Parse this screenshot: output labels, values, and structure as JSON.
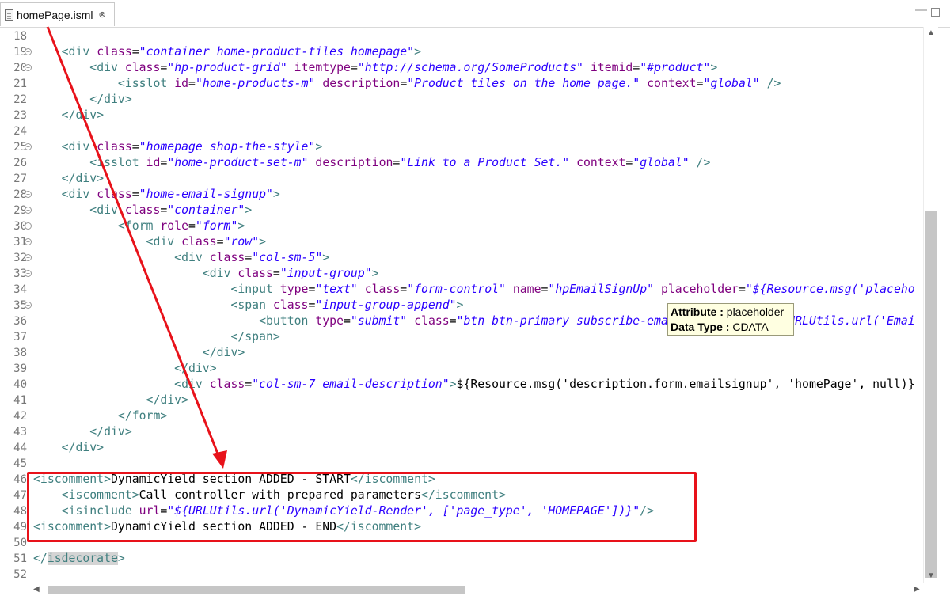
{
  "tab": {
    "filename": "homePage.isml",
    "close_glyph": "⊗"
  },
  "window": {
    "minimize_glyph": "—"
  },
  "lines": [
    {
      "n": "18",
      "fold": false,
      "parts": []
    },
    {
      "n": "19",
      "fold": true,
      "parts": [
        {
          "c": "",
          "x": "    "
        },
        {
          "c": "t",
          "x": "<div "
        },
        {
          "c": "a",
          "x": "class"
        },
        {
          "c": "",
          "x": "="
        },
        {
          "c": "v",
          "x": "\"container home-product-tiles homepage\""
        },
        {
          "c": "t",
          "x": ">"
        }
      ]
    },
    {
      "n": "20",
      "fold": true,
      "parts": [
        {
          "c": "",
          "x": "        "
        },
        {
          "c": "t",
          "x": "<div "
        },
        {
          "c": "a",
          "x": "class"
        },
        {
          "c": "",
          "x": "="
        },
        {
          "c": "v",
          "x": "\"hp-product-grid\""
        },
        {
          "c": "",
          "x": " "
        },
        {
          "c": "a",
          "x": "itemtype"
        },
        {
          "c": "",
          "x": "="
        },
        {
          "c": "v",
          "x": "\"http://schema.org/SomeProducts\""
        },
        {
          "c": "",
          "x": " "
        },
        {
          "c": "a",
          "x": "itemid"
        },
        {
          "c": "",
          "x": "="
        },
        {
          "c": "v",
          "x": "\"#product\""
        },
        {
          "c": "t",
          "x": ">"
        }
      ]
    },
    {
      "n": "21",
      "fold": false,
      "parts": [
        {
          "c": "",
          "x": "            "
        },
        {
          "c": "t",
          "x": "<isslot "
        },
        {
          "c": "a",
          "x": "id"
        },
        {
          "c": "",
          "x": "="
        },
        {
          "c": "v",
          "x": "\"home-products-m\""
        },
        {
          "c": "",
          "x": " "
        },
        {
          "c": "a",
          "x": "description"
        },
        {
          "c": "",
          "x": "="
        },
        {
          "c": "v",
          "x": "\"Product tiles on the home page.\""
        },
        {
          "c": "",
          "x": " "
        },
        {
          "c": "a",
          "x": "context"
        },
        {
          "c": "",
          "x": "="
        },
        {
          "c": "v",
          "x": "\"global\""
        },
        {
          "c": "",
          "x": " "
        },
        {
          "c": "t",
          "x": "/>"
        }
      ]
    },
    {
      "n": "22",
      "fold": false,
      "parts": [
        {
          "c": "",
          "x": "        "
        },
        {
          "c": "t",
          "x": "</div>"
        }
      ]
    },
    {
      "n": "23",
      "fold": false,
      "parts": [
        {
          "c": "",
          "x": "    "
        },
        {
          "c": "t",
          "x": "</div>"
        }
      ]
    },
    {
      "n": "24",
      "fold": false,
      "parts": []
    },
    {
      "n": "25",
      "fold": true,
      "parts": [
        {
          "c": "",
          "x": "    "
        },
        {
          "c": "t",
          "x": "<div "
        },
        {
          "c": "a",
          "x": "class"
        },
        {
          "c": "",
          "x": "="
        },
        {
          "c": "v",
          "x": "\"homepage shop-the-style\""
        },
        {
          "c": "t",
          "x": ">"
        }
      ]
    },
    {
      "n": "26",
      "fold": false,
      "parts": [
        {
          "c": "",
          "x": "        "
        },
        {
          "c": "t",
          "x": "<isslot "
        },
        {
          "c": "a",
          "x": "id"
        },
        {
          "c": "",
          "x": "="
        },
        {
          "c": "v",
          "x": "\"home-product-set-m\""
        },
        {
          "c": "",
          "x": " "
        },
        {
          "c": "a",
          "x": "description"
        },
        {
          "c": "",
          "x": "="
        },
        {
          "c": "v",
          "x": "\"Link to a Product Set.\""
        },
        {
          "c": "",
          "x": " "
        },
        {
          "c": "a",
          "x": "context"
        },
        {
          "c": "",
          "x": "="
        },
        {
          "c": "v",
          "x": "\"global\""
        },
        {
          "c": "",
          "x": " "
        },
        {
          "c": "t",
          "x": "/>"
        }
      ]
    },
    {
      "n": "27",
      "fold": false,
      "parts": [
        {
          "c": "",
          "x": "    "
        },
        {
          "c": "t",
          "x": "</div>"
        }
      ]
    },
    {
      "n": "28",
      "fold": true,
      "parts": [
        {
          "c": "",
          "x": "    "
        },
        {
          "c": "t",
          "x": "<div "
        },
        {
          "c": "a",
          "x": "class"
        },
        {
          "c": "",
          "x": "="
        },
        {
          "c": "v",
          "x": "\"home-email-signup\""
        },
        {
          "c": "t",
          "x": ">"
        }
      ]
    },
    {
      "n": "29",
      "fold": true,
      "parts": [
        {
          "c": "",
          "x": "        "
        },
        {
          "c": "t",
          "x": "<div "
        },
        {
          "c": "a",
          "x": "class"
        },
        {
          "c": "",
          "x": "="
        },
        {
          "c": "v",
          "x": "\"container\""
        },
        {
          "c": "t",
          "x": ">"
        }
      ]
    },
    {
      "n": "30",
      "fold": true,
      "parts": [
        {
          "c": "",
          "x": "            "
        },
        {
          "c": "t",
          "x": "<form "
        },
        {
          "c": "a",
          "x": "role"
        },
        {
          "c": "",
          "x": "="
        },
        {
          "c": "v",
          "x": "\"form\""
        },
        {
          "c": "t",
          "x": ">"
        }
      ]
    },
    {
      "n": "31",
      "fold": true,
      "parts": [
        {
          "c": "",
          "x": "                "
        },
        {
          "c": "t",
          "x": "<div "
        },
        {
          "c": "a",
          "x": "class"
        },
        {
          "c": "",
          "x": "="
        },
        {
          "c": "v",
          "x": "\"row\""
        },
        {
          "c": "t",
          "x": ">"
        }
      ]
    },
    {
      "n": "32",
      "fold": true,
      "parts": [
        {
          "c": "",
          "x": "                    "
        },
        {
          "c": "t",
          "x": "<div "
        },
        {
          "c": "a",
          "x": "class"
        },
        {
          "c": "",
          "x": "="
        },
        {
          "c": "v",
          "x": "\"col-sm-5\""
        },
        {
          "c": "t",
          "x": ">"
        }
      ]
    },
    {
      "n": "33",
      "fold": true,
      "parts": [
        {
          "c": "",
          "x": "                        "
        },
        {
          "c": "t",
          "x": "<div "
        },
        {
          "c": "a",
          "x": "class"
        },
        {
          "c": "",
          "x": "="
        },
        {
          "c": "v",
          "x": "\"input-group\""
        },
        {
          "c": "t",
          "x": ">"
        }
      ]
    },
    {
      "n": "34",
      "fold": false,
      "parts": [
        {
          "c": "",
          "x": "                            "
        },
        {
          "c": "t",
          "x": "<input "
        },
        {
          "c": "a",
          "x": "type"
        },
        {
          "c": "",
          "x": "="
        },
        {
          "c": "v",
          "x": "\"text\""
        },
        {
          "c": "",
          "x": " "
        },
        {
          "c": "a",
          "x": "class"
        },
        {
          "c": "",
          "x": "="
        },
        {
          "c": "v",
          "x": "\"form-control\""
        },
        {
          "c": "",
          "x": " "
        },
        {
          "c": "a",
          "x": "name"
        },
        {
          "c": "",
          "x": "="
        },
        {
          "c": "v",
          "x": "\"hpEmailSignUp\""
        },
        {
          "c": "",
          "x": " "
        },
        {
          "c": "a",
          "x": "placeholder"
        },
        {
          "c": "",
          "x": "="
        },
        {
          "c": "v",
          "x": "\"${Resource.msg('placeho"
        }
      ]
    },
    {
      "n": "35",
      "fold": true,
      "parts": [
        {
          "c": "",
          "x": "                            "
        },
        {
          "c": "t",
          "x": "<span "
        },
        {
          "c": "a",
          "x": "class"
        },
        {
          "c": "",
          "x": "="
        },
        {
          "c": "v",
          "x": "\"input-group-append\""
        },
        {
          "c": "t",
          "x": ">"
        }
      ]
    },
    {
      "n": "36",
      "fold": false,
      "parts": [
        {
          "c": "",
          "x": "                                "
        },
        {
          "c": "t",
          "x": "<button "
        },
        {
          "c": "a",
          "x": "type"
        },
        {
          "c": "",
          "x": "="
        },
        {
          "c": "v",
          "x": "\"submit\""
        },
        {
          "c": "",
          "x": " "
        },
        {
          "c": "a",
          "x": "class"
        },
        {
          "c": "",
          "x": "="
        },
        {
          "c": "v",
          "x": "\"btn btn-primary subscribe-email\" data-href=\"${URLUtils.url('Emai"
        }
      ]
    },
    {
      "n": "37",
      "fold": false,
      "parts": [
        {
          "c": "",
          "x": "                            "
        },
        {
          "c": "t",
          "x": "</span>"
        }
      ]
    },
    {
      "n": "38",
      "fold": false,
      "parts": [
        {
          "c": "",
          "x": "                        "
        },
        {
          "c": "t",
          "x": "</div>"
        }
      ]
    },
    {
      "n": "39",
      "fold": false,
      "parts": [
        {
          "c": "",
          "x": "                    "
        },
        {
          "c": "t",
          "x": "</div>"
        }
      ]
    },
    {
      "n": "40",
      "fold": false,
      "parts": [
        {
          "c": "",
          "x": "                    "
        },
        {
          "c": "t",
          "x": "<div "
        },
        {
          "c": "a",
          "x": "class"
        },
        {
          "c": "",
          "x": "="
        },
        {
          "c": "v",
          "x": "\"col-sm-7 email-description\""
        },
        {
          "c": "t",
          "x": ">"
        },
        {
          "c": "",
          "x": "${Resource.msg('description.form.emailsignup', 'homePage', null)}"
        }
      ]
    },
    {
      "n": "41",
      "fold": false,
      "parts": [
        {
          "c": "",
          "x": "                "
        },
        {
          "c": "t",
          "x": "</div>"
        }
      ]
    },
    {
      "n": "42",
      "fold": false,
      "parts": [
        {
          "c": "",
          "x": "            "
        },
        {
          "c": "t",
          "x": "</form>"
        }
      ]
    },
    {
      "n": "43",
      "fold": false,
      "parts": [
        {
          "c": "",
          "x": "        "
        },
        {
          "c": "t",
          "x": "</div>"
        }
      ]
    },
    {
      "n": "44",
      "fold": false,
      "parts": [
        {
          "c": "",
          "x": "    "
        },
        {
          "c": "t",
          "x": "</div>"
        }
      ]
    },
    {
      "n": "45",
      "fold": false,
      "parts": []
    },
    {
      "n": "46",
      "fold": false,
      "parts": [
        {
          "c": "t",
          "x": "<iscomment>"
        },
        {
          "c": "",
          "x": "DynamicYield section ADDED - START"
        },
        {
          "c": "t",
          "x": "</iscomment>"
        }
      ]
    },
    {
      "n": "47",
      "fold": false,
      "parts": [
        {
          "c": "",
          "x": "    "
        },
        {
          "c": "t",
          "x": "<iscomment>"
        },
        {
          "c": "",
          "x": "Call controller with prepared parameters"
        },
        {
          "c": "t",
          "x": "</iscomment>"
        }
      ]
    },
    {
      "n": "48",
      "fold": false,
      "parts": [
        {
          "c": "",
          "x": "    "
        },
        {
          "c": "t",
          "x": "<isinclude "
        },
        {
          "c": "a",
          "x": "url"
        },
        {
          "c": "",
          "x": "="
        },
        {
          "c": "v",
          "x": "\"${URLUtils.url('DynamicYield-Render', ['page_type', 'HOMEPAGE'])}\""
        },
        {
          "c": "t",
          "x": "/>"
        }
      ]
    },
    {
      "n": "49",
      "fold": false,
      "parts": [
        {
          "c": "t",
          "x": "<iscomment>"
        },
        {
          "c": "",
          "x": "DynamicYield section ADDED - END"
        },
        {
          "c": "t",
          "x": "</iscomment>"
        }
      ]
    },
    {
      "n": "50",
      "fold": false,
      "parts": []
    },
    {
      "n": "51",
      "fold": false,
      "parts": [
        {
          "c": "t",
          "x": "</"
        },
        {
          "c": "t hl",
          "x": "isdecorate"
        },
        {
          "c": "t",
          "x": ">"
        }
      ]
    },
    {
      "n": "52",
      "fold": false,
      "parts": []
    }
  ],
  "tooltip": {
    "attribute_label": "Attribute :",
    "attribute_value": "placeholder",
    "datatype_label": "Data Type :",
    "datatype_value": "CDATA"
  },
  "colors": {
    "tag": "#3f7f7f",
    "attribute": "#7f007f",
    "value": "#2a00ff",
    "annotation": "#e8121a"
  }
}
